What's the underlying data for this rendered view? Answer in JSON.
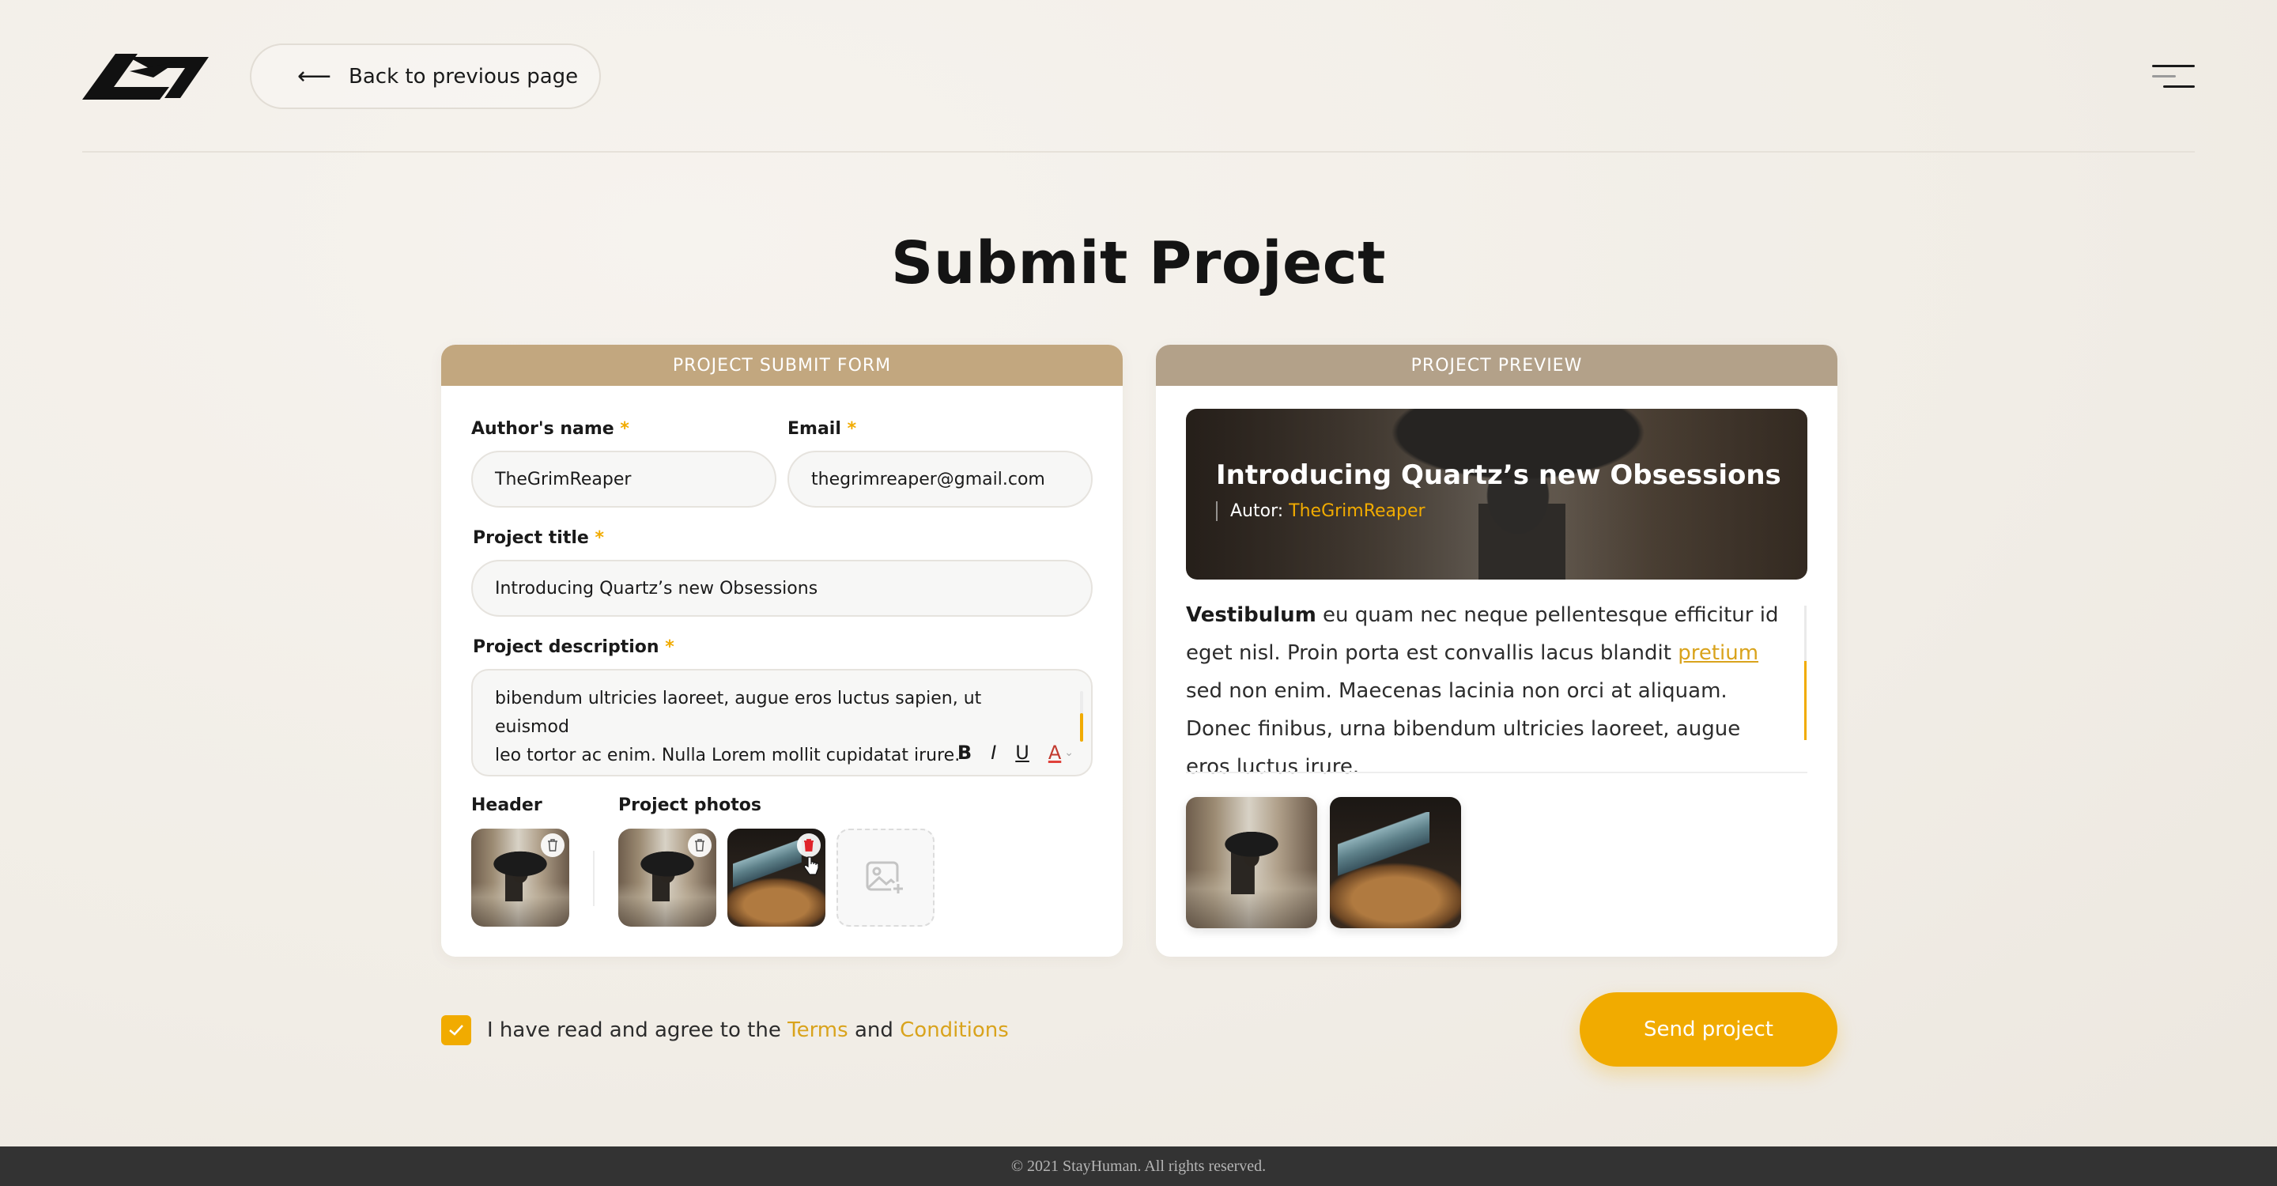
{
  "header": {
    "back_label": "Back to previous page"
  },
  "page": {
    "title": "Submit Project"
  },
  "form": {
    "heading": "PROJECT SUBMIT FORM",
    "author_label": "Author's name",
    "author_value": "TheGrimReaper",
    "email_label": "Email",
    "email_value": "thegrimreaper@gmail.com",
    "title_label": "Project title",
    "title_value": "Introducing Quartz’s new Obsessions",
    "description_label": "Project description",
    "description_line1": "bibendum ultricies laoreet, augue eros luctus sapien, ut euismod",
    "description_line2": "leo tortor ac enim. Nulla Lorem mollit cupidatat irure.",
    "required_mark": "*",
    "toolbar": {
      "bold": "B",
      "italic": "I",
      "underline": "U",
      "color": "A"
    },
    "header_label": "Header",
    "photos_label": "Project photos"
  },
  "preview": {
    "heading": "PROJECT PREVIEW",
    "title": "Introducing Quartz’s new Obsessions",
    "author_prefix": "Autor:",
    "author_name": "TheGrimReaper",
    "text_bold": "Vestibulum",
    "text_part1": " eu quam nec neque pellentesque efficitur id eget nisl. Proin porta est convallis lacus blandit ",
    "text_link": "pretium",
    "text_part2": " sed non enim. Maecenas lacinia non orci at aliquam. Donec finibus, urna bibendum ultricies laoreet, augue eros luctus irure."
  },
  "agreement": {
    "checked": true,
    "text_before": "I have read and agree to the",
    "terms": "Terms",
    "and": "and",
    "conditions": "Conditions"
  },
  "actions": {
    "send_label": "Send project"
  },
  "footer": {
    "copyright": "© 2021 StayHuman. All rights reserved."
  },
  "colors": {
    "accent": "#f1ab00",
    "form_header": "#c2a77f",
    "preview_header": "#b3a189",
    "footer_bg": "#333333"
  }
}
